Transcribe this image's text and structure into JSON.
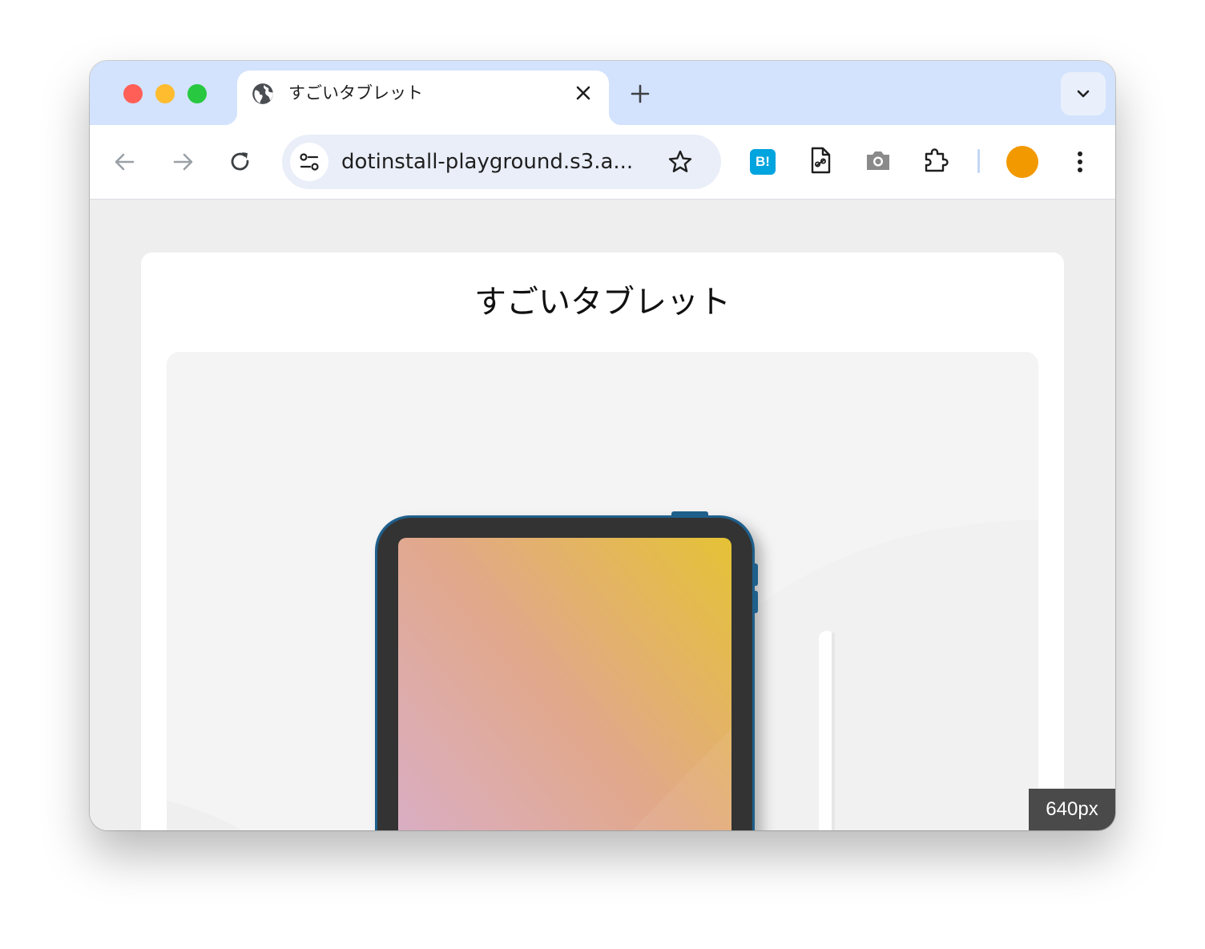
{
  "browser": {
    "tab": {
      "title": "すごいタブレット",
      "favicon": "globe-icon"
    },
    "toolbar": {
      "url": "dotinstall-playground.s3.a...",
      "back_icon": "arrow-left-icon",
      "forward_icon": "arrow-right-icon",
      "reload_icon": "reload-icon",
      "site_info_icon": "tune-icon",
      "bookmark_icon": "star-icon",
      "extensions": [
        {
          "name": "hatena-bookmark",
          "label": "B!"
        },
        {
          "name": "page-link-icon"
        },
        {
          "name": "camera-icon"
        },
        {
          "name": "puzzle-icon"
        }
      ],
      "profile_color": "#f29900"
    }
  },
  "page": {
    "heading": "すごいタブレット",
    "width_indicator": "640px"
  },
  "colors": {
    "tabstrip": "#d3e3fd",
    "tablet_frame": "#333333",
    "tablet_accent": "#1f5f8b",
    "screen_gradient": [
      "#d7b0d6",
      "#e2a88a",
      "#e5c236"
    ]
  }
}
